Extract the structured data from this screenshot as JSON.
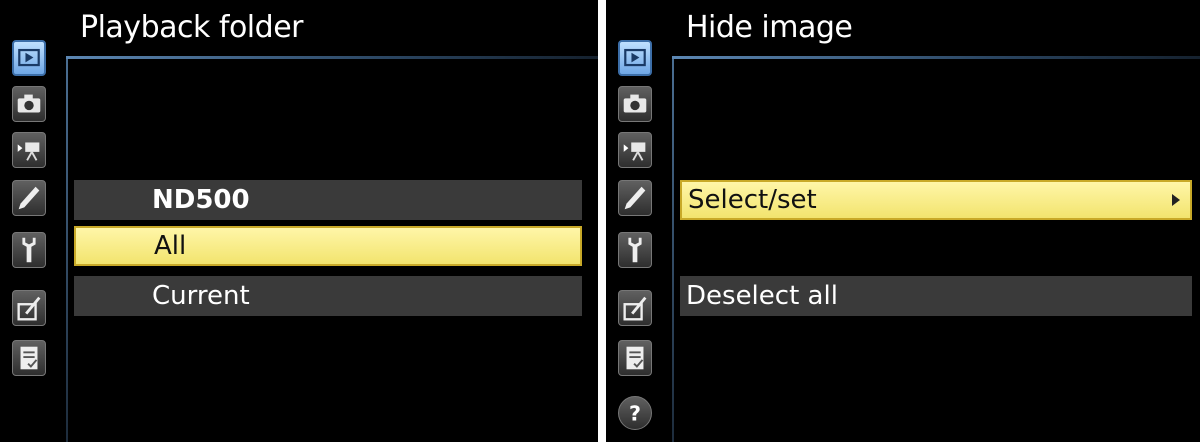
{
  "left_screen": {
    "title": "Playback folder",
    "options": [
      "ND500",
      "All",
      "Current"
    ],
    "selected_option": "All"
  },
  "right_screen": {
    "title": "Hide image",
    "options": [
      "Select/set",
      "Deselect all"
    ],
    "selected_option": "Select/set"
  },
  "sidebar_icons": [
    "playback-icon",
    "camera-icon",
    "movie-icon",
    "pencil-icon",
    "wrench-icon",
    "retouch-icon",
    "my-menu-icon",
    "help-icon"
  ],
  "colors": {
    "highlight": "#f2e46e",
    "highlight_border": "#c8a928",
    "active_tab": "#6fa7e6",
    "row_background": "#3a3a3a"
  }
}
